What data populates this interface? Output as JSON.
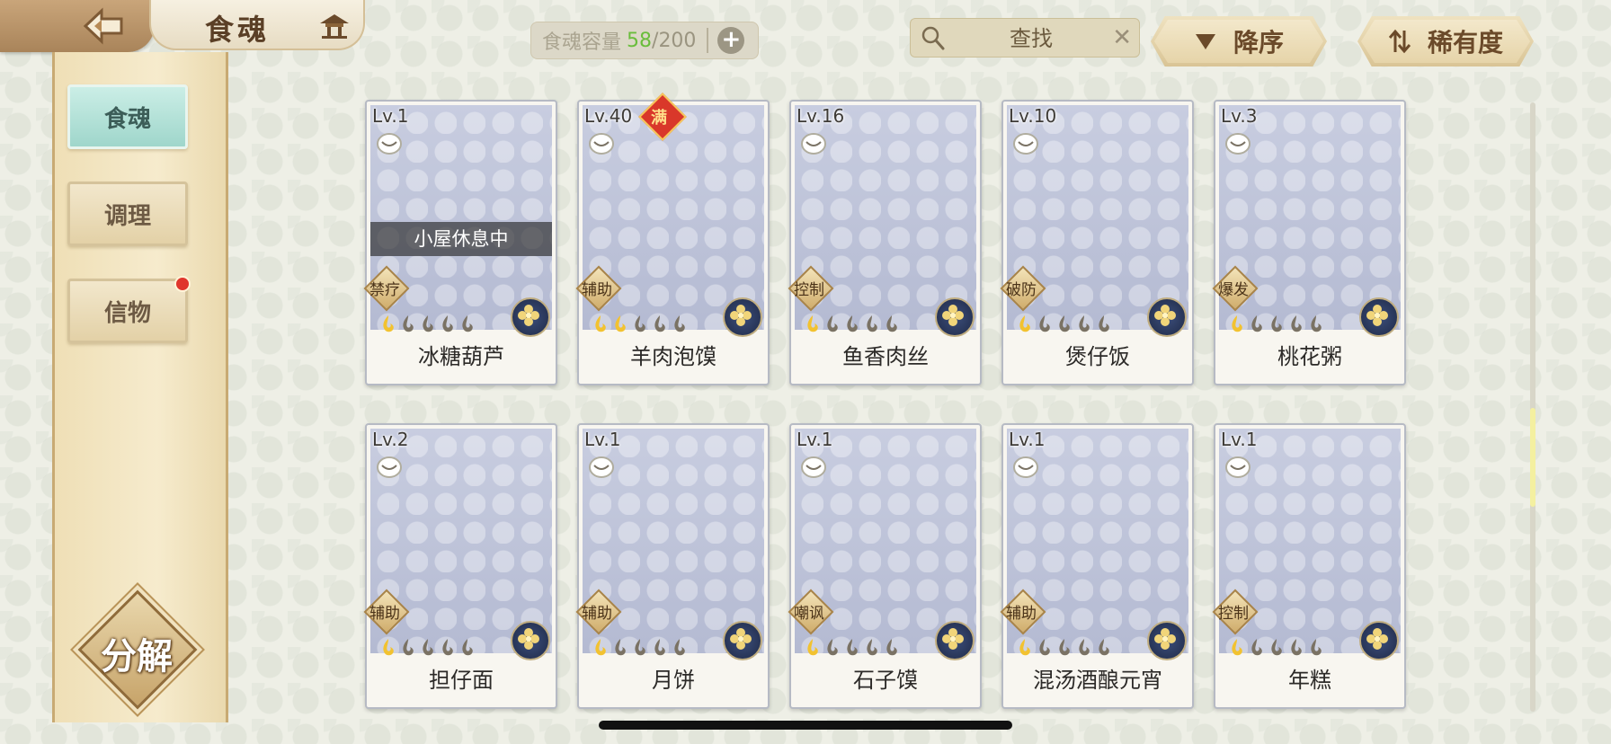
{
  "header": {
    "title": "食魂",
    "capacity_label": "食魂容量",
    "capacity_current": "58",
    "capacity_separator": "/",
    "capacity_max": "200",
    "search_placeholder": "查找",
    "sort_order_label": "降序",
    "sort_by_label": "稀有度"
  },
  "sidebar": {
    "items": [
      {
        "label": "食魂",
        "active": true
      },
      {
        "label": "调理",
        "active": false
      },
      {
        "label": "信物",
        "active": false,
        "notification": true
      }
    ],
    "decompose_label": "分解"
  },
  "cards": [
    {
      "level": "Lv.1",
      "name": "冰糖葫芦",
      "role": "禁疗",
      "status": "小屋休息中",
      "stars_filled": 1,
      "stars_total": 5
    },
    {
      "level": "Lv.40",
      "name": "羊肉泡馍",
      "role": "辅助",
      "badge": "满",
      "stars_filled": 2,
      "stars_total": 5
    },
    {
      "level": "Lv.16",
      "name": "鱼香肉丝",
      "role": "控制",
      "stars_filled": 1,
      "stars_total": 5
    },
    {
      "level": "Lv.10",
      "name": "煲仔饭",
      "role": "破防",
      "stars_filled": 1,
      "stars_total": 5
    },
    {
      "level": "Lv.3",
      "name": "桃花粥",
      "role": "爆发",
      "stars_filled": 1,
      "stars_total": 5
    },
    {
      "level": "Lv.2",
      "name": "担仔面",
      "role": "辅助",
      "stars_filled": 1,
      "stars_total": 5
    },
    {
      "level": "Lv.1",
      "name": "月饼",
      "role": "辅助",
      "stars_filled": 1,
      "stars_total": 5
    },
    {
      "level": "Lv.1",
      "name": "石子馍",
      "role": "嘲讽",
      "stars_filled": 1,
      "stars_total": 5
    },
    {
      "level": "Lv.1",
      "name": "混汤酒酿元宵",
      "role": "辅助",
      "stars_filled": 1,
      "stars_total": 5
    },
    {
      "level": "Lv.1",
      "name": "年糕",
      "role": "控制",
      "stars_filled": 1,
      "stars_total": 5
    }
  ],
  "colors": {
    "accent_active": "#9fd6cb",
    "capacity_current": "#6abd3c",
    "notification_dot": "#e0362c",
    "star_filled": "#f2c230",
    "star_empty": "#7a7264"
  }
}
